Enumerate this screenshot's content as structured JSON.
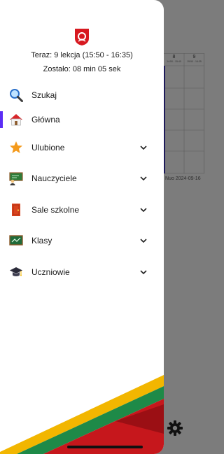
{
  "background": {
    "table_headers": [
      {
        "number": "8",
        "time": "14:50 - 15:40"
      },
      {
        "number": "9",
        "time": "15:50 - 16:35"
      }
    ],
    "note": "Nuo 2024-09-16"
  },
  "drawer": {
    "status_line_1": "Teraz: 9 lekcja (15:50 - 16:35)",
    "status_line_2": "Zostało: 08 min 05 sek",
    "items": [
      {
        "label": "Szukaj",
        "icon": "search-icon"
      },
      {
        "label": "Główna",
        "icon": "home-icon",
        "active": true
      },
      {
        "label": "Ulubione",
        "icon": "star-icon",
        "expandable": true
      },
      {
        "label": "Nauczyciele",
        "icon": "teacher-icon",
        "expandable": true
      },
      {
        "label": "Sale szkolne",
        "icon": "door-icon",
        "expandable": true
      },
      {
        "label": "Klasy",
        "icon": "chalkboard-icon",
        "expandable": true
      },
      {
        "label": "Uczniowie",
        "icon": "graduation-cap-icon",
        "expandable": true
      }
    ]
  },
  "colors": {
    "accent": "#5b2df5",
    "flag_yellow": "#f2b600",
    "flag_green": "#1e8a48",
    "flag_red": "#c6171c"
  }
}
